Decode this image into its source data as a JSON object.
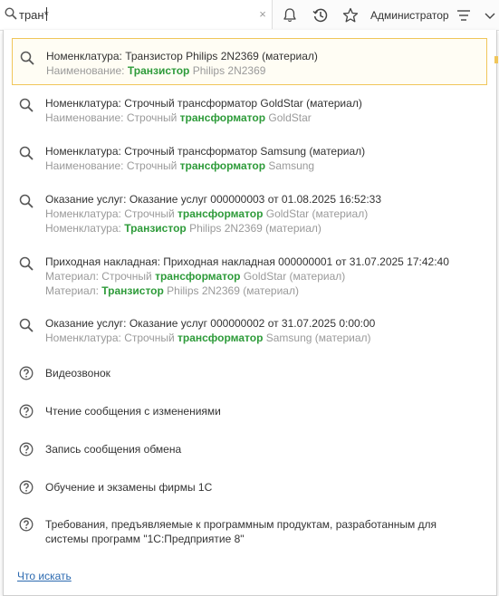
{
  "search": {
    "value": "тран*",
    "clear_glyph": "×"
  },
  "header": {
    "user_name": "Администратор",
    "icons": [
      "search-icon",
      "bell-icon",
      "history-icon",
      "star-icon",
      "menu-icon",
      "chevron-down-icon"
    ]
  },
  "colors": {
    "highlight": "#2e9b3a",
    "selection_border": "#f0c65a",
    "link": "#2c6ab0"
  },
  "results": [
    {
      "title": "Номенклатура: Транзистор Philips 2N2369 (материал)",
      "details": [
        {
          "prefix": "Наименование: ",
          "match": "Транзистор",
          "suffix": " Philips 2N2369"
        }
      ]
    },
    {
      "title": "Номенклатура: Строчный трансформатор GoldStar (материал)",
      "details": [
        {
          "prefix": "Наименование: Строчный ",
          "match": "трансформатор",
          "suffix": " GoldStar"
        }
      ]
    },
    {
      "title": "Номенклатура: Строчный трансформатор Samsung (материал)",
      "details": [
        {
          "prefix": "Наименование: Строчный ",
          "match": "трансформатор",
          "suffix": " Samsung"
        }
      ]
    },
    {
      "title": "Оказание услуг: Оказание услуг 000000003 от 01.08.2025 16:52:33",
      "details": [
        {
          "prefix": "Номенклатура: Строчный ",
          "match": "трансформатор",
          "suffix": " GoldStar (материал)"
        },
        {
          "prefix": "Номенклатура: ",
          "match": "Транзистор",
          "suffix": " Philips 2N2369 (материал)"
        }
      ]
    },
    {
      "title": "Приходная накладная: Приходная накладная 000000001 от 31.07.2025 17:42:40",
      "details": [
        {
          "prefix": "Материал: Строчный ",
          "match": "трансформатор",
          "suffix": " GoldStar (материал)"
        },
        {
          "prefix": "Материал: ",
          "match": "Транзистор",
          "suffix": " Philips 2N2369 (материал)"
        }
      ]
    },
    {
      "title": "Оказание услуг: Оказание услуг 000000002 от 31.07.2025 0:00:00",
      "details": [
        {
          "prefix": "Номенклатура: Строчный ",
          "match": "трансформатор",
          "suffix": " Samsung (материал)"
        }
      ]
    }
  ],
  "help_results": [
    {
      "lines": [
        "Видеозвонок"
      ]
    },
    {
      "lines": [
        "Чтение сообщения с изменениями"
      ]
    },
    {
      "lines": [
        "Запись сообщения обмена"
      ]
    },
    {
      "lines": [
        "Обучение и экзамены фирмы 1С"
      ]
    },
    {
      "lines": [
        "Требования, предъявляемые к программным продуктам, разработанным для",
        "системы программ \"1С:Предприятие 8\""
      ]
    }
  ],
  "footer": {
    "link_label": "Что искать"
  }
}
